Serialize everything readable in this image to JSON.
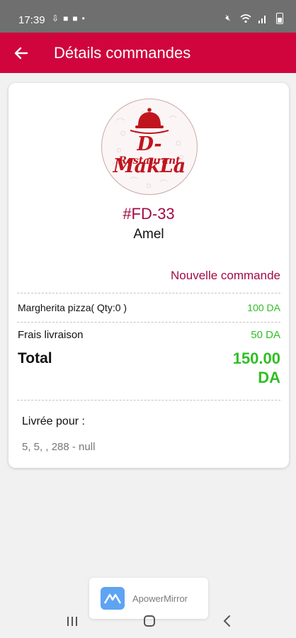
{
  "status_bar": {
    "time": "17:39",
    "left_icons": [
      "download-icon",
      "shop-icon",
      "shop-icon",
      "dot-icon"
    ],
    "right_icons": [
      "mute-icon",
      "wifi-icon",
      "signal-icon",
      "battery-icon"
    ]
  },
  "app_bar": {
    "title": "Détails commandes",
    "back_icon": "arrow-left-icon",
    "color": "#d0053d"
  },
  "logo": {
    "title": "D-MakLa",
    "subtitle": "Restaurant"
  },
  "order": {
    "number": "#FD-33",
    "customer": "Amel",
    "status": "Nouvelle commande",
    "item_label": "Margherita pizza( Qty:0 )",
    "item_price": "100 DA",
    "delivery_label": "Frais livraison",
    "delivery_price": "50 DA",
    "total_label": "Total",
    "total_amount": "150.00",
    "total_currency": "DA"
  },
  "delivery": {
    "label": "Livrée pour :",
    "address": "5, 5, , 288 - null"
  },
  "watermark": {
    "text": "ApowerMirror"
  },
  "colors": {
    "accent": "#d0053d",
    "order_text": "#a30a44",
    "price": "#2fbf24"
  }
}
